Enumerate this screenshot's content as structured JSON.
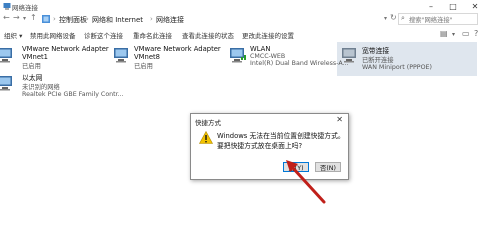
{
  "window": {
    "title": "网络连接"
  },
  "address": {
    "crumbs": [
      "控制面板",
      "网络和 Internet",
      "网络连接"
    ],
    "search_placeholder": "搜索\"网络连接\""
  },
  "toolbar": {
    "items": [
      "组织 ▾",
      "禁用此网络设备",
      "诊断这个连接",
      "重命名此连接",
      "查看此连接的状态",
      "更改此连接的设置"
    ]
  },
  "connections": [
    {
      "name": "VMware Network Adapter VMnet1",
      "line1": "VMware Network Adapter",
      "line2": "VMnet1",
      "line3": "已启用"
    },
    {
      "name": "VMware Network Adapter VMnet8",
      "line1": "VMware Network Adapter",
      "line2": "VMnet8",
      "line3": "已启用"
    },
    {
      "name": "WLAN",
      "line1": "WLAN",
      "line2": "CMCC-WEB",
      "line3": "Intel(R) Dual Band Wireless-A..."
    },
    {
      "name": "宽带连接",
      "line1": "宽带连接",
      "line2": "已断开连接",
      "line3": "WAN Miniport (PPPOE)"
    },
    {
      "name": "以太网",
      "line1": "以太网",
      "line2": "未识别的网络",
      "line3": "Realtek PCIe GBE Family Contr..."
    }
  ],
  "dialog": {
    "title": "快捷方式",
    "message_line1": "Windows 无法在当前位置创建快捷方式。",
    "message_line2": "要把快捷方式放在桌面上吗?",
    "yes_label": "是(Y)",
    "no_label": "否(N)"
  },
  "colors": {
    "arrow": "#c0201a",
    "selection": "#dfe6ee",
    "warning": "#f2c200"
  }
}
